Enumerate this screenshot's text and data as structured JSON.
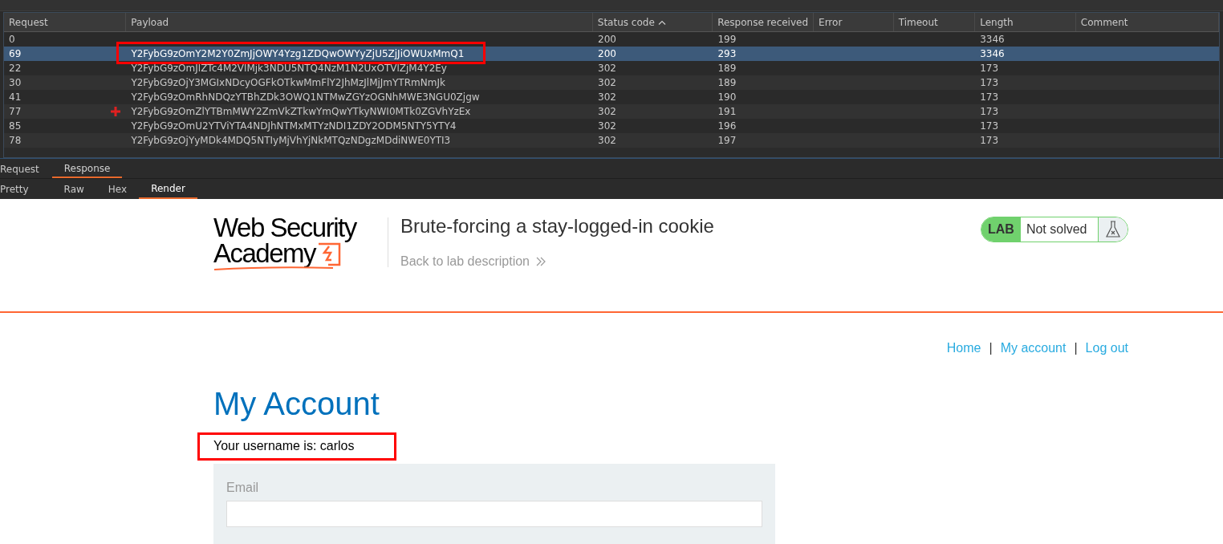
{
  "results_table": {
    "columns": [
      {
        "label": "Request",
        "sorted": false
      },
      {
        "label": "Payload",
        "sorted": false
      },
      {
        "label": "Status code",
        "sorted": true
      },
      {
        "label": "Response received",
        "sorted": false
      },
      {
        "label": "Error",
        "sorted": false
      },
      {
        "label": "Timeout",
        "sorted": false
      },
      {
        "label": "Length",
        "sorted": false
      },
      {
        "label": "Comment",
        "sorted": false
      }
    ],
    "rows": [
      {
        "request": "0",
        "payload": "",
        "status": "200",
        "received": "199",
        "length": "3346",
        "selected": false,
        "highlighted": false,
        "flagged": false
      },
      {
        "request": "69",
        "payload": "Y2FybG9zOmY2M2Y0ZmJjOWY4Yzg1ZDQwOWYyZjU5ZjJiOWUxMmQ1",
        "status": "200",
        "received": "293",
        "length": "3346",
        "selected": true,
        "highlighted": true,
        "flagged": false
      },
      {
        "request": "22",
        "payload": "Y2FybG9zOmJlZTc4M2VlMjk3NDU5NTQ4NzM1N2UxOTVlZjM4Y2Ey",
        "status": "302",
        "received": "189",
        "length": "173",
        "selected": false,
        "highlighted": false,
        "flagged": false
      },
      {
        "request": "30",
        "payload": "Y2FybG9zOjY3MGIxNDcyOGFkOTkwMmFlY2JhMzJlMjJmYTRmNmJk",
        "status": "302",
        "received": "189",
        "length": "173",
        "selected": false,
        "highlighted": false,
        "flagged": false
      },
      {
        "request": "41",
        "payload": "Y2FybG9zOmRhNDQzYTBhZDk3OWQ1NTMwZGYzOGNhMWE3NGU0Zjgw",
        "status": "302",
        "received": "190",
        "length": "173",
        "selected": false,
        "highlighted": false,
        "flagged": false
      },
      {
        "request": "77",
        "payload": "Y2FybG9zOmZlYTBmMWY2ZmVkZTkwYmQwYTkyNWI0MTk0ZGVhYzEx",
        "status": "302",
        "received": "191",
        "length": "173",
        "selected": false,
        "highlighted": false,
        "flagged": true
      },
      {
        "request": "85",
        "payload": "Y2FybG9zOmU2YTViYTA4NDJhNTMxMTYzNDI1ZDY2ODM5NTY5YTY4",
        "status": "302",
        "received": "196",
        "length": "173",
        "selected": false,
        "highlighted": false,
        "flagged": false
      },
      {
        "request": "78",
        "payload": "Y2FybG9zOjYyMDk4MDQ5NTIyMjVhYjNkMTQzNDgzMDdiNWE0YTI3",
        "status": "302",
        "received": "197",
        "length": "173",
        "selected": false,
        "highlighted": false,
        "flagged": false
      }
    ]
  },
  "message_tabs": [
    {
      "label": "Request",
      "selected": false
    },
    {
      "label": "Response",
      "selected": true
    }
  ],
  "view_tabs": [
    {
      "label": "Pretty",
      "selected": false
    },
    {
      "label": "Raw",
      "selected": false
    },
    {
      "label": "Hex",
      "selected": false
    },
    {
      "label": "Render",
      "selected": true
    }
  ],
  "page": {
    "logo": {
      "line1": "Web Security",
      "line2": "Academy"
    },
    "title": "Brute-forcing a stay-logged-in cookie",
    "back_link": "Back to lab description",
    "lab_badge": {
      "label": "LAB",
      "status": "Not solved",
      "solved": false
    },
    "nav": [
      {
        "label": "Home"
      },
      {
        "label": "My account"
      },
      {
        "label": "Log out"
      }
    ],
    "nav_separator": "|",
    "heading": "My Account",
    "username_text": "Your username is: carlos",
    "username_highlighted": true,
    "form": {
      "label": "Email"
    }
  }
}
